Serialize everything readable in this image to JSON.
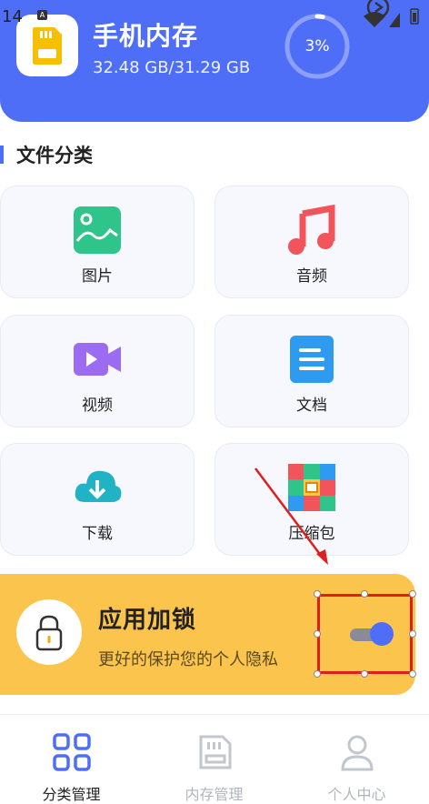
{
  "status_bar": {
    "time": "14"
  },
  "storage": {
    "title": "手机内存",
    "used_text": "32.48 GB/31.29 GB",
    "percent_label": "3%",
    "percent_value": 3
  },
  "section": {
    "title": "文件分类"
  },
  "categories": [
    {
      "label": "图片",
      "icon": "image-icon"
    },
    {
      "label": "音频",
      "icon": "music-icon"
    },
    {
      "label": "视频",
      "icon": "video-icon"
    },
    {
      "label": "文档",
      "icon": "document-icon"
    },
    {
      "label": "下载",
      "icon": "cloud-download-icon"
    },
    {
      "label": "压缩包",
      "icon": "archive-icon"
    }
  ],
  "app_lock": {
    "title": "应用加锁",
    "description": "更好的保护您的个人隐私",
    "toggle_on": true
  },
  "bottom_nav": [
    {
      "label": "分类管理",
      "icon": "category-grid-icon",
      "active": true
    },
    {
      "label": "内存管理",
      "icon": "memory-icon",
      "active": false
    },
    {
      "label": "个人中心",
      "icon": "person-icon",
      "active": false
    }
  ],
  "colors": {
    "primary": "#4f6ef7",
    "lock_card": "#fbc44d",
    "annotation": "#e11d1d"
  }
}
